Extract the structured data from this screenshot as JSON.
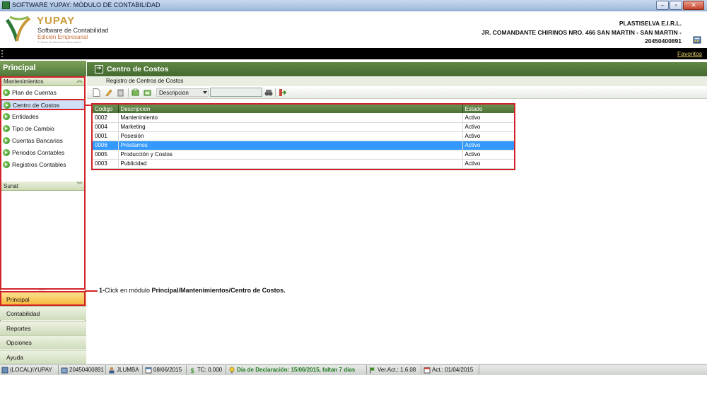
{
  "window": {
    "title": "SOFTWARE YUPAY: MÓDULO DE CONTABILIDAD",
    "minimize_label": "–",
    "maximize_label": "▫",
    "close_label": "✕"
  },
  "header": {
    "brand_name": "YUPAY",
    "brand_subtitle": "Software de Contabilidad",
    "brand_edition": "Edición Empresarial",
    "brand_tagline": "© Todos los Derechos Reservados",
    "company_name": "PLASTISELVA E.I.R.L.",
    "company_address": "JR. COMANDANTE CHIRINOS NRO. 466 SAN MARTIN - SAN MARTIN -",
    "company_ruc": "20450400891"
  },
  "topbar": {
    "favorites_label": "Favoritos"
  },
  "sidebar": {
    "title": "Principal",
    "group_mantenimientos": "Mantenimientos",
    "group_sunat": "Sunat",
    "items": [
      {
        "label": "Plan de Cuentas"
      },
      {
        "label": "Centro de Costos"
      },
      {
        "label": "Entidades"
      },
      {
        "label": "Tipo de Cambio"
      },
      {
        "label": "Cuentas Bancarias"
      },
      {
        "label": "Periodos Contables"
      },
      {
        "label": "Registros Contables"
      }
    ],
    "resize_handle": "••••••",
    "nav": [
      {
        "label": "Principal"
      },
      {
        "label": "Contabilidad"
      },
      {
        "label": "Reportes"
      },
      {
        "label": "Opciones"
      },
      {
        "label": "Ayuda"
      }
    ]
  },
  "main": {
    "title": "Centro de Costos",
    "subtitle": "Registro de Centros de Costos",
    "search_field_select": "Descripcion",
    "search_value": "",
    "table": {
      "columns": [
        "Codigo",
        "Descripcion",
        "Estado"
      ],
      "rows": [
        [
          "0002",
          "Mantenimiento",
          "Activo"
        ],
        [
          "0004",
          "Marketing",
          "Activo"
        ],
        [
          "0001",
          "Posesión",
          "Activo"
        ],
        [
          "0006",
          "Préstamos",
          "Activo"
        ],
        [
          "0005",
          "Producción y Costos",
          "Activo"
        ],
        [
          "0003",
          "Publicidad",
          "Activo"
        ]
      ],
      "selected_row": 3
    }
  },
  "annotation": {
    "prefix": "1-",
    "text": "Click en módulo ",
    "bold": "Principal/Mantenimientos/Centro de Costos."
  },
  "statusbar": {
    "server": "(LOCAL)\\YUPAY",
    "ruc": "20450400891",
    "user": "JLUMBA",
    "date": "08/06/2015",
    "tc": "TC: 0.000",
    "declaration": "Día de Declaración: 15/06/2015, faltan 7 días",
    "version": "Ver.Act.: 1.6.08",
    "update": "Act.: 01/04/2015"
  },
  "colors": {
    "accent_green": "#50783a",
    "selection_blue": "#3399ff",
    "annotation_red": "#d2232a",
    "active_nav": "#f5b335"
  },
  "icons": [
    "app-icon",
    "logo-mark",
    "calculator-icon",
    "go-arrow-icon",
    "chevron-up-icon",
    "chevron-down-icon",
    "new-doc-icon",
    "edit-icon",
    "delete-icon",
    "export-icon",
    "import-icon",
    "binoculars-icon",
    "exit-icon",
    "database-icon",
    "user-icon",
    "calendar-icon",
    "dollar-icon",
    "bulb-icon",
    "flag-icon"
  ]
}
